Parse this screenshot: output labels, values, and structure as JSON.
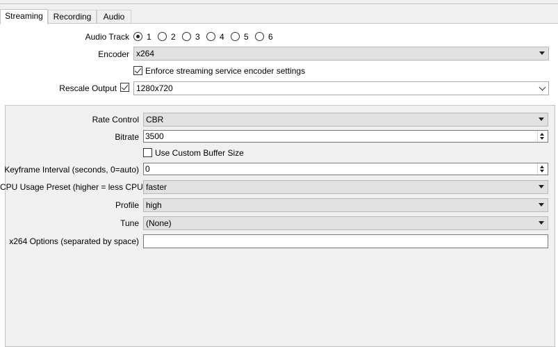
{
  "tabs": [
    {
      "label": "Streaming"
    },
    {
      "label": "Recording"
    },
    {
      "label": "Audio"
    }
  ],
  "audio_track": {
    "label": "Audio Track",
    "options": [
      "1",
      "2",
      "3",
      "4",
      "5",
      "6"
    ],
    "selected": "1"
  },
  "encoder": {
    "label": "Encoder",
    "value": "x264"
  },
  "enforce": {
    "label": "Enforce streaming service encoder settings",
    "checked": true
  },
  "rescale": {
    "label": "Rescale Output",
    "checked": true,
    "value": "1280x720"
  },
  "settings": {
    "rate_control": {
      "label": "Rate Control",
      "value": "CBR"
    },
    "bitrate": {
      "label": "Bitrate",
      "value": "3500"
    },
    "custom_buffer": {
      "label": "Use Custom Buffer Size",
      "checked": false
    },
    "keyframe": {
      "label": "Keyframe Interval (seconds, 0=auto)",
      "value": "0"
    },
    "cpu_preset": {
      "label": "CPU Usage Preset (higher = less CPU)",
      "value": "faster"
    },
    "profile": {
      "label": "Profile",
      "value": "high"
    },
    "tune": {
      "label": "Tune",
      "value": "(None)"
    },
    "x264_options": {
      "label": "x264 Options (separated by space)",
      "value": ""
    }
  }
}
